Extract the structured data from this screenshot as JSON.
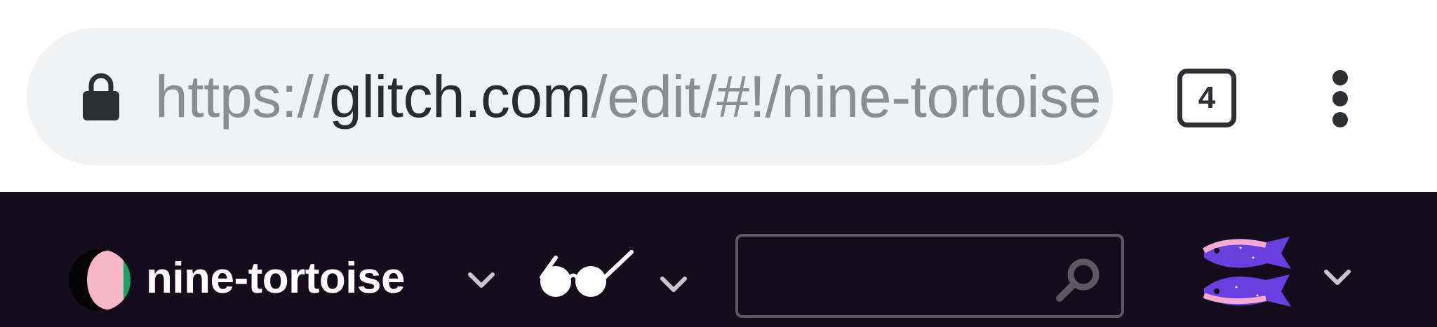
{
  "browser": {
    "url_prefix": "https://",
    "url_host": "glitch.com",
    "url_path": "/edit/#!/nine-tortoise",
    "tab_count": "4",
    "icons": [
      "lock-icon",
      "more-vert-icon"
    ]
  },
  "glitch_header": {
    "project_name": "nine-tortoise",
    "search": {
      "value": "",
      "placeholder": ""
    },
    "icons": [
      "project-logo-icon",
      "glasses-icon",
      "search-icon",
      "fish-avatar-icon",
      "chevron-down-icon"
    ]
  },
  "colors": {
    "chrome_bg": "#ffffff",
    "omnibox_bg": "#f1f2f4",
    "url_host_text": "#2a2b2e",
    "url_dim_text": "#8b8d91",
    "header_bg": "#150d1c",
    "header_text": "#ffffff",
    "search_border": "#5c5862"
  }
}
